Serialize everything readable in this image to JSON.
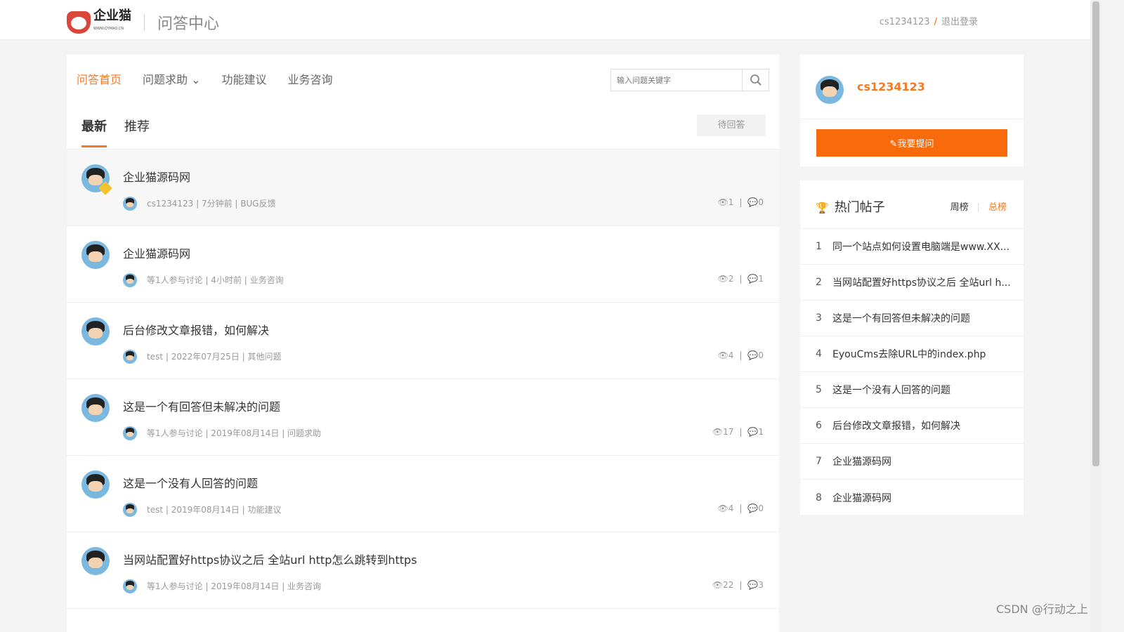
{
  "header": {
    "logo_text": "企业猫",
    "logo_sub": "WWW.QYMAO.CN",
    "site_title": "问答中心",
    "username": "cs1234123",
    "logout": "退出登录"
  },
  "nav": {
    "items": [
      "问答首页",
      "问题求助 ⌄",
      "功能建议",
      "业务咨询"
    ],
    "search_placeholder": "输入问题关键字"
  },
  "tabs": {
    "latest": "最新",
    "recommend": "推荐",
    "pending": "待回答"
  },
  "posts": [
    {
      "title": "企业猫源码网",
      "meta": "cs1234123 | 7分钟前 | BUG反馈",
      "views": "1",
      "replies": "0"
    },
    {
      "title": "企业猫源码网",
      "meta": "等1人参与讨论 | 4小时前 | 业务咨询",
      "views": "2",
      "replies": "1"
    },
    {
      "title": "后台修改文章报错，如何解决",
      "meta": "test | 2022年07月25日 | 其他问题",
      "views": "4",
      "replies": "0"
    },
    {
      "title": "这是一个有回答但未解决的问题",
      "meta": "等1人参与讨论 | 2019年08月14日 | 问题求助",
      "views": "17",
      "replies": "1"
    },
    {
      "title": "这是一个没有人回答的问题",
      "meta": "test | 2019年08月14日 | 功能建议",
      "views": "4",
      "replies": "0"
    },
    {
      "title": "当网站配置好https协议之后 全站url http怎么跳转到https",
      "meta": "等1人参与讨论 | 2019年08月14日 | 业务咨询",
      "views": "22",
      "replies": "3"
    }
  ],
  "sidebar": {
    "username": "cs1234123",
    "ask_button": "✎我要提问",
    "hot_title": "热门帖子",
    "weekly": "周榜",
    "total": "总榜",
    "hot": [
      {
        "n": "1",
        "t": "同一个站点如何设置电脑端是www.XX..."
      },
      {
        "n": "2",
        "t": "当网站配置好https协议之后 全站url h..."
      },
      {
        "n": "3",
        "t": "这是一个有回答但未解决的问题"
      },
      {
        "n": "4",
        "t": "EyouCms去除URL中的index.php"
      },
      {
        "n": "5",
        "t": "这是一个没有人回答的问题"
      },
      {
        "n": "6",
        "t": "后台修改文章报错，如何解决"
      },
      {
        "n": "7",
        "t": "企业猫源码网"
      },
      {
        "n": "8",
        "t": "企业猫源码网"
      }
    ]
  },
  "watermark": "CSDN @行动之上",
  "colors": {
    "accent": "#f47920",
    "button": "#f76b0d"
  }
}
